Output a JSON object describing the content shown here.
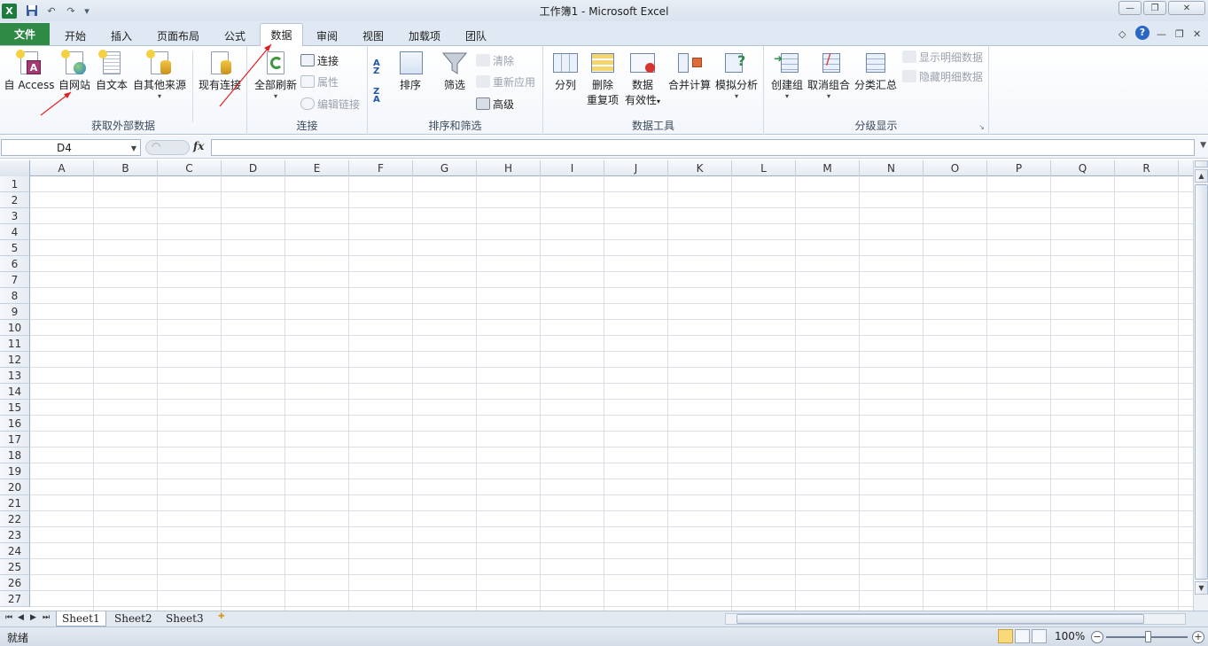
{
  "window": {
    "title": "工作簿1 - Microsoft Excel",
    "logo": "X"
  },
  "qat": {
    "undo_icon": "undo-icon",
    "redo_icon": "redo-icon",
    "save_icon": "save-icon"
  },
  "tabs": [
    {
      "label": "文件"
    },
    {
      "label": "开始"
    },
    {
      "label": "插入"
    },
    {
      "label": "页面布局"
    },
    {
      "label": "公式"
    },
    {
      "label": "数据"
    },
    {
      "label": "审阅"
    },
    {
      "label": "视图"
    },
    {
      "label": "加载项"
    },
    {
      "label": "团队"
    }
  ],
  "ribbon": {
    "external": {
      "label": "获取外部数据",
      "access": "自 Access",
      "web": "自网站",
      "text": "自文本",
      "other": "自其他来源",
      "existing": "现有连接"
    },
    "connections": {
      "label": "连接",
      "refresh_all": "全部刷新",
      "connections": "连接",
      "properties": "属性",
      "edit_links": "编辑链接"
    },
    "sort_filter": {
      "label": "排序和筛选",
      "sort": "排序",
      "filter": "筛选",
      "clear": "清除",
      "reapply": "重新应用",
      "advanced": "高级",
      "az": "A\nZ",
      "za": "Z\nA"
    },
    "data_tools": {
      "label": "数据工具",
      "text_to_columns": "分列",
      "remove_dup_1": "删除",
      "remove_dup_2": "重复项",
      "validation_1": "数据",
      "validation_2": "有效性",
      "consolidate": "合并计算",
      "what_if": "模拟分析"
    },
    "outline": {
      "label": "分级显示",
      "group": "创建组",
      "ungroup": "取消组合",
      "subtotal": "分类汇总",
      "show_detail": "显示明细数据",
      "hide_detail": "隐藏明细数据"
    }
  },
  "formula_bar": {
    "name_box": "D4",
    "fx": "fx",
    "value": ""
  },
  "columns": [
    "A",
    "B",
    "C",
    "D",
    "E",
    "F",
    "G",
    "H",
    "I",
    "J",
    "K",
    "L",
    "M",
    "N",
    "O",
    "P",
    "Q",
    "R"
  ],
  "rows": [
    "1",
    "2",
    "3",
    "4",
    "5",
    "6",
    "7",
    "8",
    "9",
    "10",
    "11",
    "12",
    "13",
    "14",
    "15",
    "16",
    "17",
    "18",
    "19",
    "20",
    "21",
    "22",
    "23",
    "24",
    "25",
    "26",
    "27"
  ],
  "sheets": [
    "Sheet1",
    "Sheet2",
    "Sheet3"
  ],
  "status": {
    "text": "就绪",
    "zoom": "100%"
  }
}
